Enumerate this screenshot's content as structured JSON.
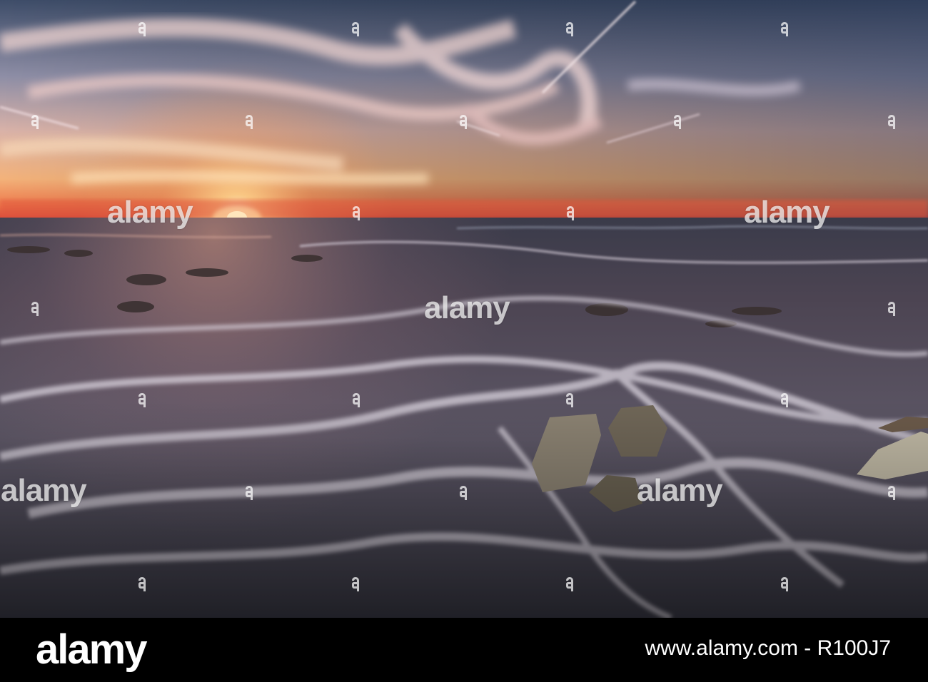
{
  "photo": {
    "subject": "sunset-over-sea-with-rocks",
    "colors": {
      "sky_top": "#3b4a66",
      "sky_mid": "#c9a6a8",
      "horizon_glow": "#f2a15c",
      "horizon_red": "#e0533b",
      "sea_dark": "#2a2f3d",
      "foam": "#d9d4dc"
    }
  },
  "watermark": {
    "text": "alamy",
    "icon": "alamy-a-icon"
  },
  "footer": {
    "logo": "alamy",
    "ref": "www.alamy.com - R100J7"
  }
}
